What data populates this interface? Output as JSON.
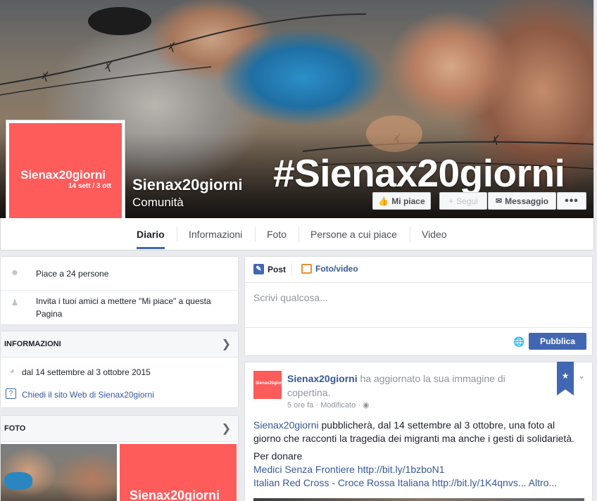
{
  "cover": {
    "hashtag": "#Sienax20giorni",
    "page_name": "Sienax20giorni",
    "category": "Comunità"
  },
  "profile_pic": {
    "brand": "Sienax20giorni",
    "dates": "14 sett / 3 ott"
  },
  "cover_buttons": {
    "like": "Mi piace",
    "follow": "Segui",
    "message": "Messaggio",
    "more": "•••"
  },
  "nav": {
    "tabs": [
      "Diario",
      "Informazioni",
      "Foto",
      "Persone a cui piace",
      "Video"
    ],
    "active": "Diario"
  },
  "left": {
    "likes_text": "Piace a 24 persone",
    "invite_text": "Invita i tuoi amici a mettere \"Mi piace\" a questa Pagina",
    "info": {
      "header": "INFORMAZIONI",
      "dates": "dal 14 settembre al 3 ottobre 2015",
      "website": "Chiedi il sito Web di Sienax20giorni"
    },
    "photos": {
      "header": "FOTO",
      "thumb2_text": "Sienax20giorni"
    }
  },
  "composer": {
    "tab_post": "Post",
    "tab_photo": "Foto/video",
    "placeholder": "Scrivi qualcosa...",
    "publish": "Pubblica"
  },
  "post": {
    "avatar_text": "Sienax20giorni",
    "author": "Sienax20giorni",
    "action": "ha aggiornato la sua immagine di copertina.",
    "meta": "5 ore fa · Modificato ·",
    "body_link": "Sienax20giorni",
    "body_rest": "pubblicherà, dal 14 settembre al 3 ottobre, una foto al giorno che racconti la tragedia dei migranti ma anche i gesti di solidarietà.",
    "donate_label": "Per donare",
    "link1": "Medici Senza Frontiere http://bit.ly/1bzboN1",
    "link2": "Italian Red Cross - Croce Rossa Italiana http://bit.ly/1K4qnvs...",
    "more": "Altro..."
  },
  "colors": {
    "brand_red": "#fe5b5b",
    "fb_blue": "#4267b2",
    "link_blue": "#365899",
    "bg": "#e9ebee"
  }
}
